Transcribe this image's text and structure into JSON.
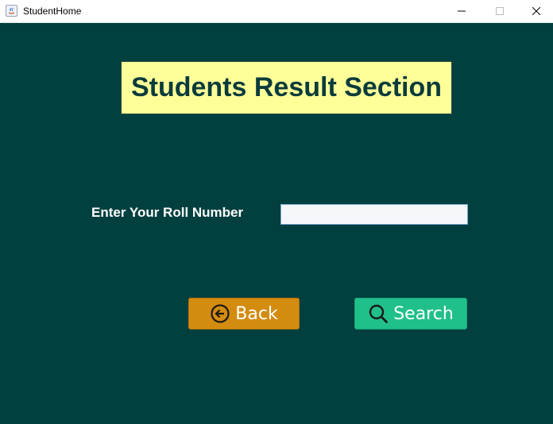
{
  "window": {
    "title": "StudentHome"
  },
  "main": {
    "heading": "Students Result Section",
    "roll_label": "Enter Your Roll Number",
    "roll_value": "",
    "back_label": "Back",
    "search_label": "Search"
  },
  "colors": {
    "background": "#024040",
    "heading_bg": "#ffff99",
    "back_button": "#d48c10",
    "search_button": "#20c08a"
  },
  "icons": {
    "app": "java-icon",
    "back": "back-arrow-circle-icon",
    "search": "search-icon"
  }
}
